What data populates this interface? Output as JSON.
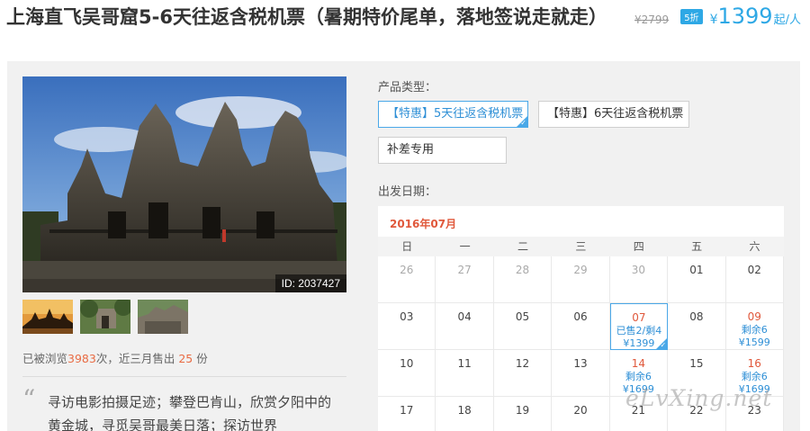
{
  "header": {
    "title": "上海直飞吴哥窟5-6天往返含税机票（暑期特价尾单，落地签说走就走）",
    "original_price": "¥2799",
    "discount": "5折",
    "currency": "¥",
    "price": "1399",
    "per_unit": "起/人"
  },
  "gallery": {
    "photo_id": "ID: 2037427",
    "thumbnails": [
      "sunset-temple",
      "jungle-ruins",
      "stone-ruins"
    ]
  },
  "stats": {
    "prefix": "已被浏览",
    "views": "3983",
    "middle": "次，近三月售出 ",
    "sold": "25",
    "suffix": " 份"
  },
  "description": "寻访电影拍摄足迹；攀登巴肯山，欣赏夕阳中的黄金城，寻觅吴哥最美日落；探访世界",
  "product": {
    "label": "产品类型：",
    "options": [
      {
        "label": "【特惠】5天往返含税机票",
        "selected": true
      },
      {
        "label": "【特惠】6天往返含税机票",
        "selected": false
      },
      {
        "label": "补差专用",
        "selected": false
      }
    ]
  },
  "calendar": {
    "label": "出发日期：",
    "month": "2016年07月",
    "weekdays": [
      "日",
      "一",
      "二",
      "三",
      "四",
      "五",
      "六"
    ],
    "cells": [
      {
        "day": "26",
        "muted": true
      },
      {
        "day": "27",
        "muted": true
      },
      {
        "day": "28",
        "muted": true
      },
      {
        "day": "29",
        "muted": true
      },
      {
        "day": "30",
        "muted": true
      },
      {
        "day": "01"
      },
      {
        "day": "02"
      },
      {
        "day": "03"
      },
      {
        "day": "04"
      },
      {
        "day": "05"
      },
      {
        "day": "06"
      },
      {
        "day": "07",
        "red": true,
        "selected": true,
        "line1": "已售2/剩4",
        "line2": "¥1399"
      },
      {
        "day": "08"
      },
      {
        "day": "09",
        "red": true,
        "line1": "剩余6",
        "line2": "¥1599"
      },
      {
        "day": "10"
      },
      {
        "day": "11"
      },
      {
        "day": "12"
      },
      {
        "day": "13"
      },
      {
        "day": "14",
        "red": true,
        "line1": "剩余6",
        "line2": "¥1699"
      },
      {
        "day": "15"
      },
      {
        "day": "16",
        "red": true,
        "line1": "剩余6",
        "line2": "¥1699"
      },
      {
        "day": "17"
      },
      {
        "day": "18"
      },
      {
        "day": "19"
      },
      {
        "day": "20"
      },
      {
        "day": "21"
      },
      {
        "day": "22"
      },
      {
        "day": "23"
      }
    ]
  },
  "watermark": "eLvXing.net",
  "colors": {
    "accent": "#2ea8e5",
    "highlight": "#e0583b"
  }
}
